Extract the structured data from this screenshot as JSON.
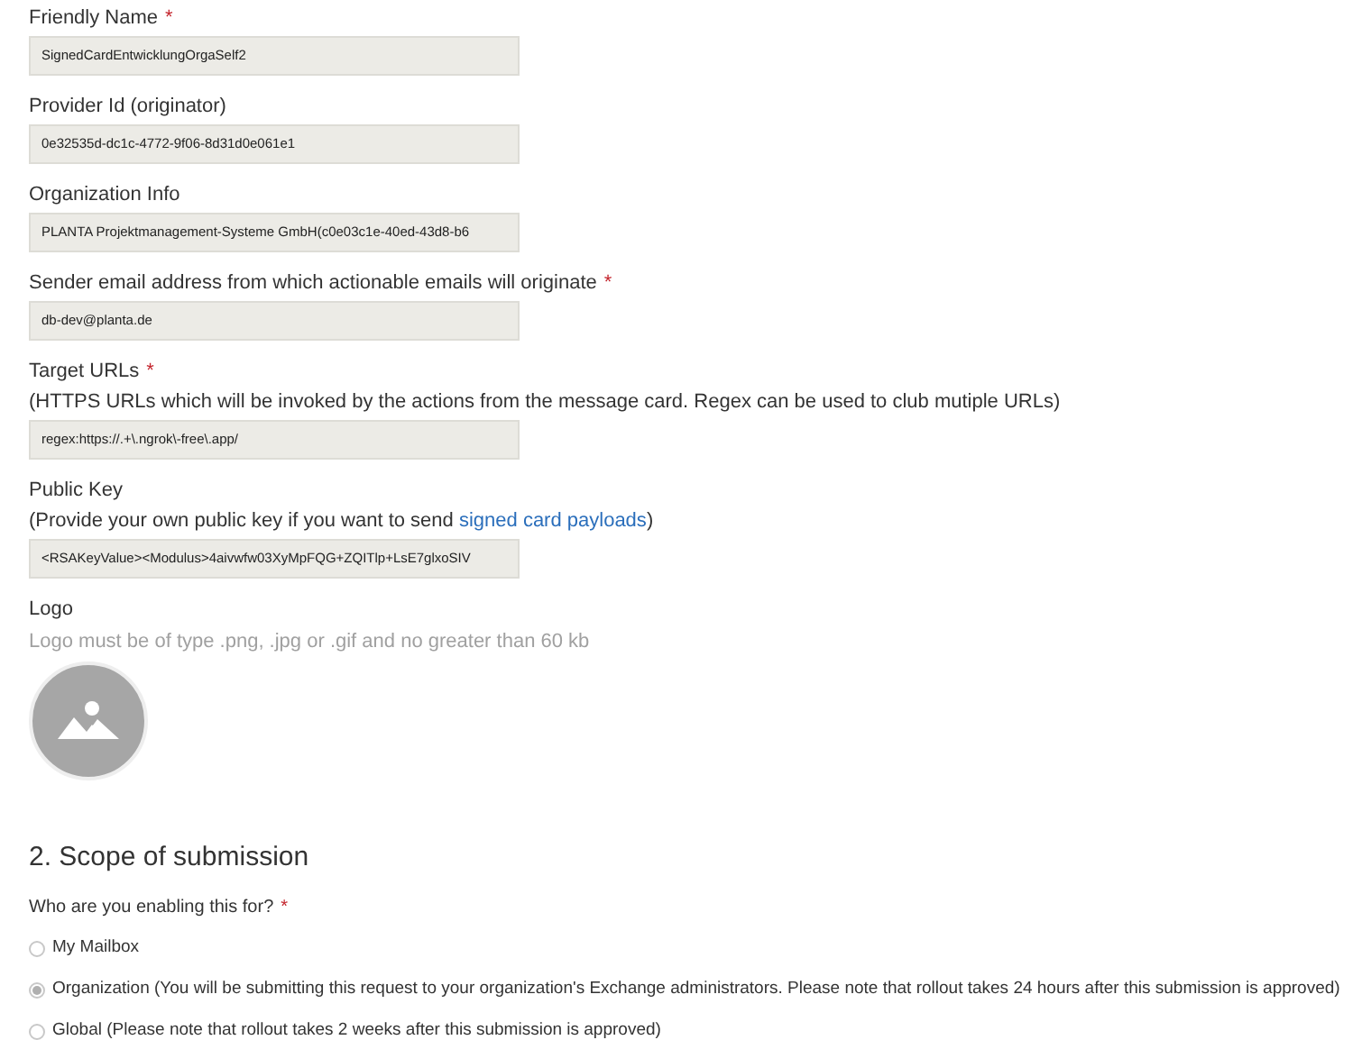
{
  "fields": [
    {
      "label": "Friendly Name",
      "asterisk": "*",
      "value": "SignedCardEntwicklungOrgaSelf2"
    },
    {
      "label": "Provider Id (originator)",
      "value": "0e32535d-dc1c-4772-9f06-8d31d0e061e1"
    },
    {
      "label": "Organization Info",
      "value": "PLANTA Projektmanagement-Systeme GmbH(c0e03c1e-40ed-43d8-b6"
    },
    {
      "label": "Sender email address from which actionable emails will originate",
      "asterisk": "*",
      "value": "db-dev@planta.de"
    },
    {
      "label": "Target URLs",
      "asterisk": "*",
      "hint": [
        {
          "kind": "text",
          "text": "(HTTPS URLs which will be invoked by the actions from the message card. Regex can be used to club mutiple URLs)"
        }
      ],
      "value": "regex:https://.+\\.ngrok\\-free\\.app/"
    },
    {
      "label": "Public Key",
      "hint": [
        {
          "kind": "text",
          "text": "(Provide your own public key if you want to send "
        },
        {
          "kind": "link",
          "text": "signed card payloads"
        },
        {
          "kind": "text",
          "text": ")"
        }
      ],
      "value": "<RSAKeyValue><Modulus>4aivwfw03XyMpFQG+ZQITlp+LsE7glxoSIV"
    }
  ],
  "logo": {
    "label": "Logo",
    "note": "Logo must be of type .png, .jpg or .gif and no greater than 60 kb"
  },
  "scope": {
    "heading": "2. Scope of submission",
    "question": "Who are you enabling this for?",
    "asterisk": "*",
    "options": [
      {
        "label": "My Mailbox",
        "selected": false
      },
      {
        "label": "Organization (You will be submitting this request to your organization's Exchange administrators. Please note that rollout takes 24 hours after this submission is approved)",
        "selected": true
      },
      {
        "label": "Global (Please note that rollout takes 2 weeks after this submission is approved)",
        "selected": false
      }
    ]
  }
}
